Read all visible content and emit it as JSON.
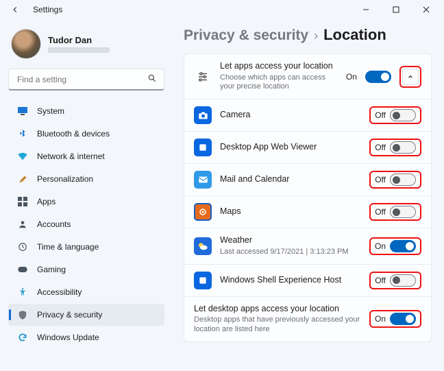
{
  "window": {
    "title": "Settings"
  },
  "user": {
    "name": "Tudor Dan"
  },
  "search": {
    "placeholder": "Find a setting"
  },
  "nav": [
    {
      "label": "System"
    },
    {
      "label": "Bluetooth & devices"
    },
    {
      "label": "Network & internet"
    },
    {
      "label": "Personalization"
    },
    {
      "label": "Apps"
    },
    {
      "label": "Accounts"
    },
    {
      "label": "Time & language"
    },
    {
      "label": "Gaming"
    },
    {
      "label": "Accessibility"
    },
    {
      "label": "Privacy & security"
    },
    {
      "label": "Windows Update"
    }
  ],
  "breadcrumb": {
    "parent": "Privacy & security",
    "current": "Location"
  },
  "section_header": {
    "title": "Let apps access your location",
    "sub": "Choose which apps can access your precise location",
    "state": "On"
  },
  "apps": [
    {
      "label": "Camera",
      "state": "Off"
    },
    {
      "label": "Desktop App Web Viewer",
      "state": "Off"
    },
    {
      "label": "Mail and Calendar",
      "state": "Off"
    },
    {
      "label": "Maps",
      "state": "Off"
    },
    {
      "label": "Weather",
      "sub": "Last accessed 9/17/2021 | 3:13:23 PM",
      "state": "On"
    },
    {
      "label": "Windows Shell Experience Host",
      "state": "Off"
    }
  ],
  "desktop_section": {
    "title": "Let desktop apps access your location",
    "sub": "Desktop apps that have previously accessed your location are listed here",
    "state": "On"
  }
}
